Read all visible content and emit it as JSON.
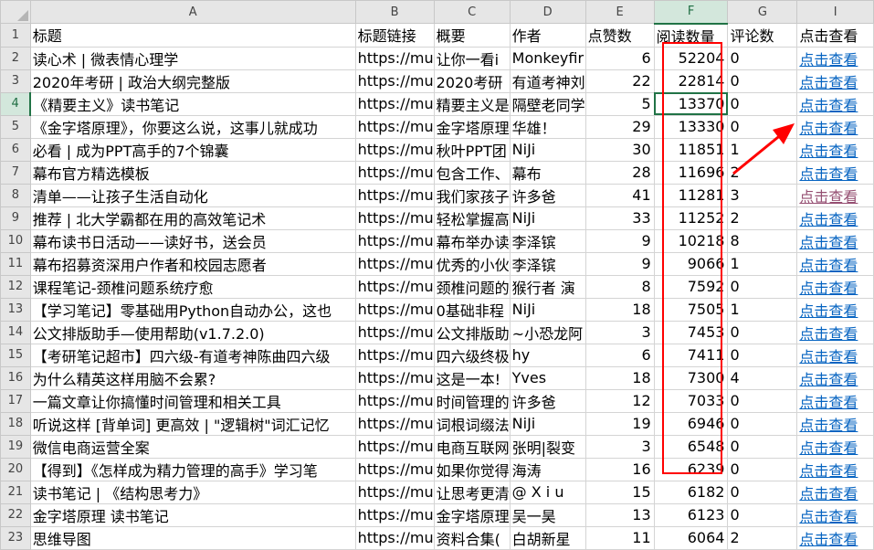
{
  "columns": [
    "A",
    "B",
    "C",
    "D",
    "E",
    "F",
    "G",
    "I"
  ],
  "selected_column": "F",
  "selected_row": "4",
  "header_row": {
    "num": "1",
    "cells": [
      "标题",
      "标题链接",
      "概要",
      "作者",
      "点赞数",
      "阅读数量",
      "评论数",
      "点击查看"
    ]
  },
  "rows": [
    {
      "num": "2",
      "title": "读心术 | 微表情心理学",
      "link": "https://mu",
      "summary": "让你一看i",
      "author": "Monkeyfir",
      "likes": "6",
      "reads": "52204",
      "comments": "0",
      "view": "点击查看"
    },
    {
      "num": "3",
      "title": "2020年考研 | 政治大纲完整版",
      "link": "https://mu",
      "summary": "2020考研",
      "author": "有道考神刘",
      "likes": "22",
      "reads": "22814",
      "comments": "0",
      "view": "点击查看"
    },
    {
      "num": "4",
      "title": "《精要主义》读书笔记",
      "link": "https://mu",
      "summary": "精要主义是",
      "author": "隔壁老同学",
      "likes": "5",
      "reads": "13370",
      "comments": "0",
      "view": "点击查看"
    },
    {
      "num": "5",
      "title": "《金字塔原理》，你要这么说，这事儿就成功",
      "link": "https://mu",
      "summary": "金字塔原理",
      "author": "华雄！",
      "likes": "29",
      "reads": "13330",
      "comments": "0",
      "view": "点击查看"
    },
    {
      "num": "6",
      "title": "必看 | 成为PPT高手的7个锦囊",
      "link": "https://mu",
      "summary": "秋叶PPT团",
      "author": "NiJi",
      "likes": "30",
      "reads": "11851",
      "comments": "1",
      "view": "点击查看"
    },
    {
      "num": "7",
      "title": "幕布官方精选模板",
      "link": "https://mu",
      "summary": "包含工作、",
      "author": "幕布",
      "likes": "28",
      "reads": "11696",
      "comments": "2",
      "view": "点击查看"
    },
    {
      "num": "8",
      "title": "清单——让孩子生活自动化",
      "link": "https://mu",
      "summary": "我们家孩子",
      "author": "许多爸",
      "likes": "41",
      "reads": "11281",
      "comments": "3",
      "view": "点击查看",
      "visited": true
    },
    {
      "num": "9",
      "title": "推荐 | 北大学霸都在用的高效笔记术",
      "link": "https://mu",
      "summary": "轻松掌握高",
      "author": "NiJi",
      "likes": "33",
      "reads": "11252",
      "comments": "2",
      "view": "点击查看"
    },
    {
      "num": "10",
      "title": "幕布读书日活动——读好书，送会员",
      "link": "https://mu",
      "summary": "幕布举办读",
      "author": "李泽镔",
      "likes": "9",
      "reads": "10218",
      "comments": "8",
      "view": "点击查看"
    },
    {
      "num": "11",
      "title": "幕布招募资深用户作者和校园志愿者",
      "link": "https://mu",
      "summary": "优秀的小伙",
      "author": "李泽镔",
      "likes": "9",
      "reads": "9066",
      "comments": "1",
      "view": "点击查看"
    },
    {
      "num": "12",
      "title": "课程笔记-颈椎问题系统疗愈",
      "link": "https://mu",
      "summary": "颈椎问题的",
      "author": "猴行者 演",
      "likes": "8",
      "reads": "7592",
      "comments": "0",
      "view": "点击查看"
    },
    {
      "num": "13",
      "title": "【学习笔记】零基础用Python自动办公，这也",
      "link": "https://mu",
      "summary": "0基础非程",
      "author": "NiJi",
      "likes": "18",
      "reads": "7505",
      "comments": "1",
      "view": "点击查看"
    },
    {
      "num": "14",
      "title": "公文排版助手—使用帮助(v1.7.2.0)",
      "link": "https://mu",
      "summary": "公文排版助",
      "author": "~小恐龙阿",
      "likes": "3",
      "reads": "7453",
      "comments": "0",
      "view": "点击查看"
    },
    {
      "num": "15",
      "title": "【考研笔记超市】四六级-有道考神陈曲四六级",
      "link": "https://mu",
      "summary": "四六级终极",
      "author": "hy",
      "likes": "6",
      "reads": "7411",
      "comments": "0",
      "view": "点击查看"
    },
    {
      "num": "16",
      "title": "为什么精英这样用脑不会累?",
      "link": "https://mu",
      "summary": "这是一本!",
      "author": "Yves",
      "likes": "18",
      "reads": "7300",
      "comments": "4",
      "view": "点击查看"
    },
    {
      "num": "17",
      "title": "一篇文章让你搞懂时间管理和相关工具",
      "link": "https://mu",
      "summary": "时间管理的",
      "author": "许多爸",
      "likes": "12",
      "reads": "7033",
      "comments": "0",
      "view": "点击查看"
    },
    {
      "num": "18",
      "title": "听说这样 [背单词] 更高效 | \"逻辑树\"词汇记忆",
      "link": "https://mu",
      "summary": "词根词缀法",
      "author": "NiJi",
      "likes": "19",
      "reads": "6946",
      "comments": "0",
      "view": "点击查看"
    },
    {
      "num": "19",
      "title": "微信电商运营全案",
      "link": "https://mu",
      "summary": "电商互联网",
      "author": "张明|裂变",
      "likes": "3",
      "reads": "6548",
      "comments": "0",
      "view": "点击查看"
    },
    {
      "num": "20",
      "title": "【得到】《怎样成为精力管理的高手》学习笔",
      "link": "https://mu",
      "summary": "如果你觉得",
      "author": "海涛",
      "likes": "16",
      "reads": "6239",
      "comments": "0",
      "view": "点击查看"
    },
    {
      "num": "21",
      "title": "读书笔记 | 《结构思考力》",
      "link": "https://mu",
      "summary": "让思考更清",
      "author": "@ X i u",
      "likes": "15",
      "reads": "6182",
      "comments": "0",
      "view": "点击查看"
    },
    {
      "num": "22",
      "title": "金字塔原理 读书笔记",
      "link": "https://mu",
      "summary": "金字塔原理",
      "author": "吴一昊",
      "likes": "13",
      "reads": "6123",
      "comments": "0",
      "view": "点击查看"
    },
    {
      "num": "23",
      "title": "思维导图",
      "link": "https://mu",
      "summary": "资料合集(",
      "author": "白胡新星",
      "likes": "11",
      "reads": "6064",
      "comments": "2",
      "view": "点击查看"
    }
  ],
  "annotation": {
    "box_color": "#ff0000",
    "arrow_color": "#ff0000"
  },
  "colors": {
    "link": "#0563c1",
    "visited_link": "#954f72",
    "selection": "#217346"
  }
}
